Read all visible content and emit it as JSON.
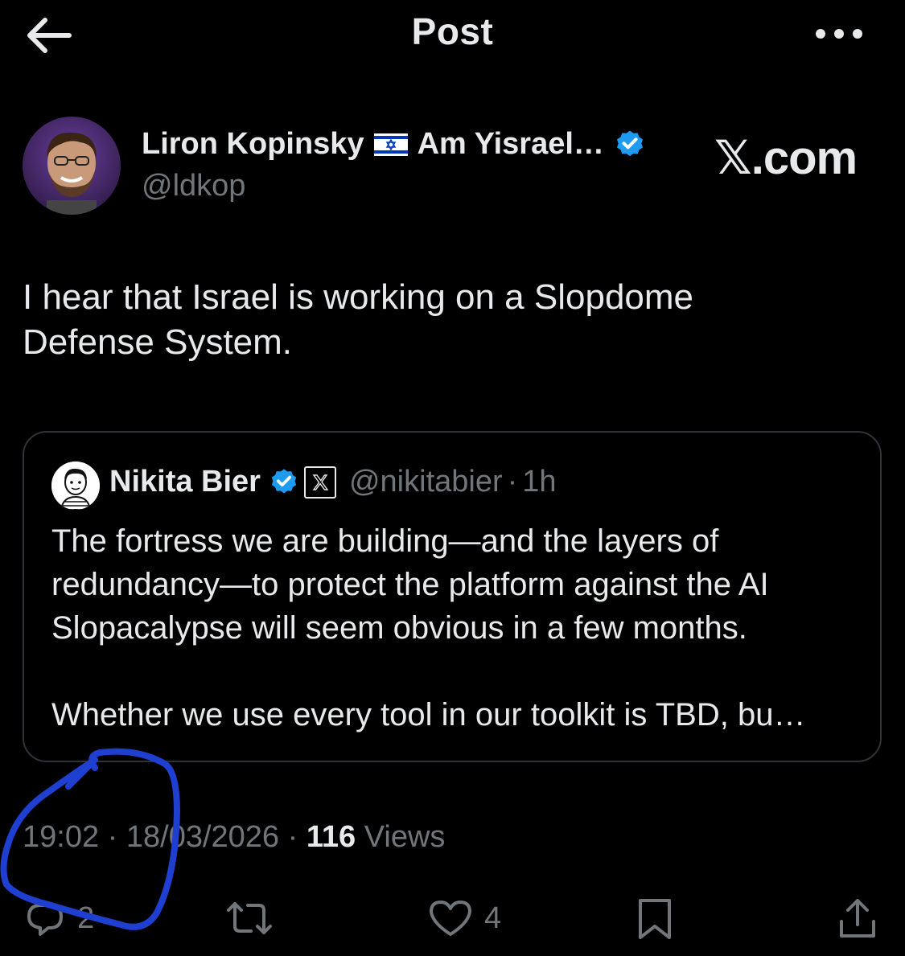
{
  "header": {
    "title": "Post",
    "back_icon": "arrow-left-icon",
    "more_icon": "more-horizontal-icon"
  },
  "author": {
    "name": "Liron Kopinsky",
    "flag_icon": "israel-flag-icon",
    "name_suffix": "Am Yisrael…",
    "handle": "@ldkop",
    "verified_color": "#1d9bf0"
  },
  "site_label": "𝕏.com",
  "post": {
    "line1": "I hear that Israel is working on a Slopdome",
    "line2": "Defense System."
  },
  "quote": {
    "name": "Nikita Bier",
    "handle": "@nikitabier",
    "separator": "·",
    "time": "1h",
    "line1": "The fortress we are building—and the layers of",
    "line2": "redundancy—to protect the platform against the AI",
    "line3": "Slopacalypse will seem obvious in a few months.",
    "line4": "Whether we use every tool in our toolkit is TBD, bu…"
  },
  "meta": {
    "time": "19:02",
    "sep1": " · ",
    "date": "18/03/2026",
    "sep2": " · ",
    "views_count": "116",
    "views_label": " Views"
  },
  "actions": {
    "reply_count": "2",
    "like_count": "4"
  },
  "colors": {
    "background": "#000000",
    "text": "#e7e9ea",
    "muted": "#71767b",
    "accent": "#1d9bf0",
    "annotation": "#1f3fd1"
  }
}
